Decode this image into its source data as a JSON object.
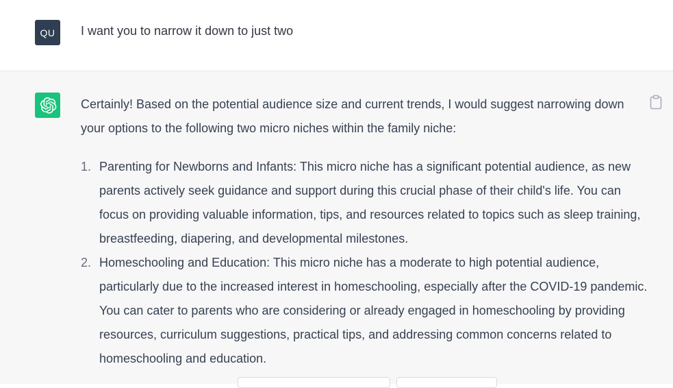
{
  "user_message": {
    "avatar_initials": "QU",
    "text": "I want you to narrow it down to just two"
  },
  "assistant_message": {
    "intro": "Certainly! Based on the potential audience size and current trends, I would suggest narrowing down your options to the following two micro niches within the family niche:",
    "items": [
      {
        "number": "1.",
        "text": "Parenting for Newborns and Infants: This micro niche has a significant potential audience, as new parents actively seek guidance and support during this crucial phase of their child's life. You can focus on providing valuable information, tips, and resources related to topics such as sleep training, breastfeeding, diapering, and developmental milestones."
      },
      {
        "number": "2.",
        "text": "Homeschooling and Education: This micro niche has a moderate to high potential audience, particularly due to the increased interest in homeschooling, especially after the COVID-19 pandemic. You can cater to parents who are considering or already engaged in homeschooling by providing resources, curriculum suggestions, practical tips, and addressing common concerns related to homeschooling and education."
      }
    ]
  },
  "colors": {
    "user_avatar_bg": "#2f3e50",
    "bot_avatar_bg": "#19c37d",
    "assistant_bg": "#f7f7f8",
    "text": "#374151"
  },
  "icons": {
    "bot_avatar": "openai-logo-icon",
    "copy": "clipboard-icon"
  }
}
